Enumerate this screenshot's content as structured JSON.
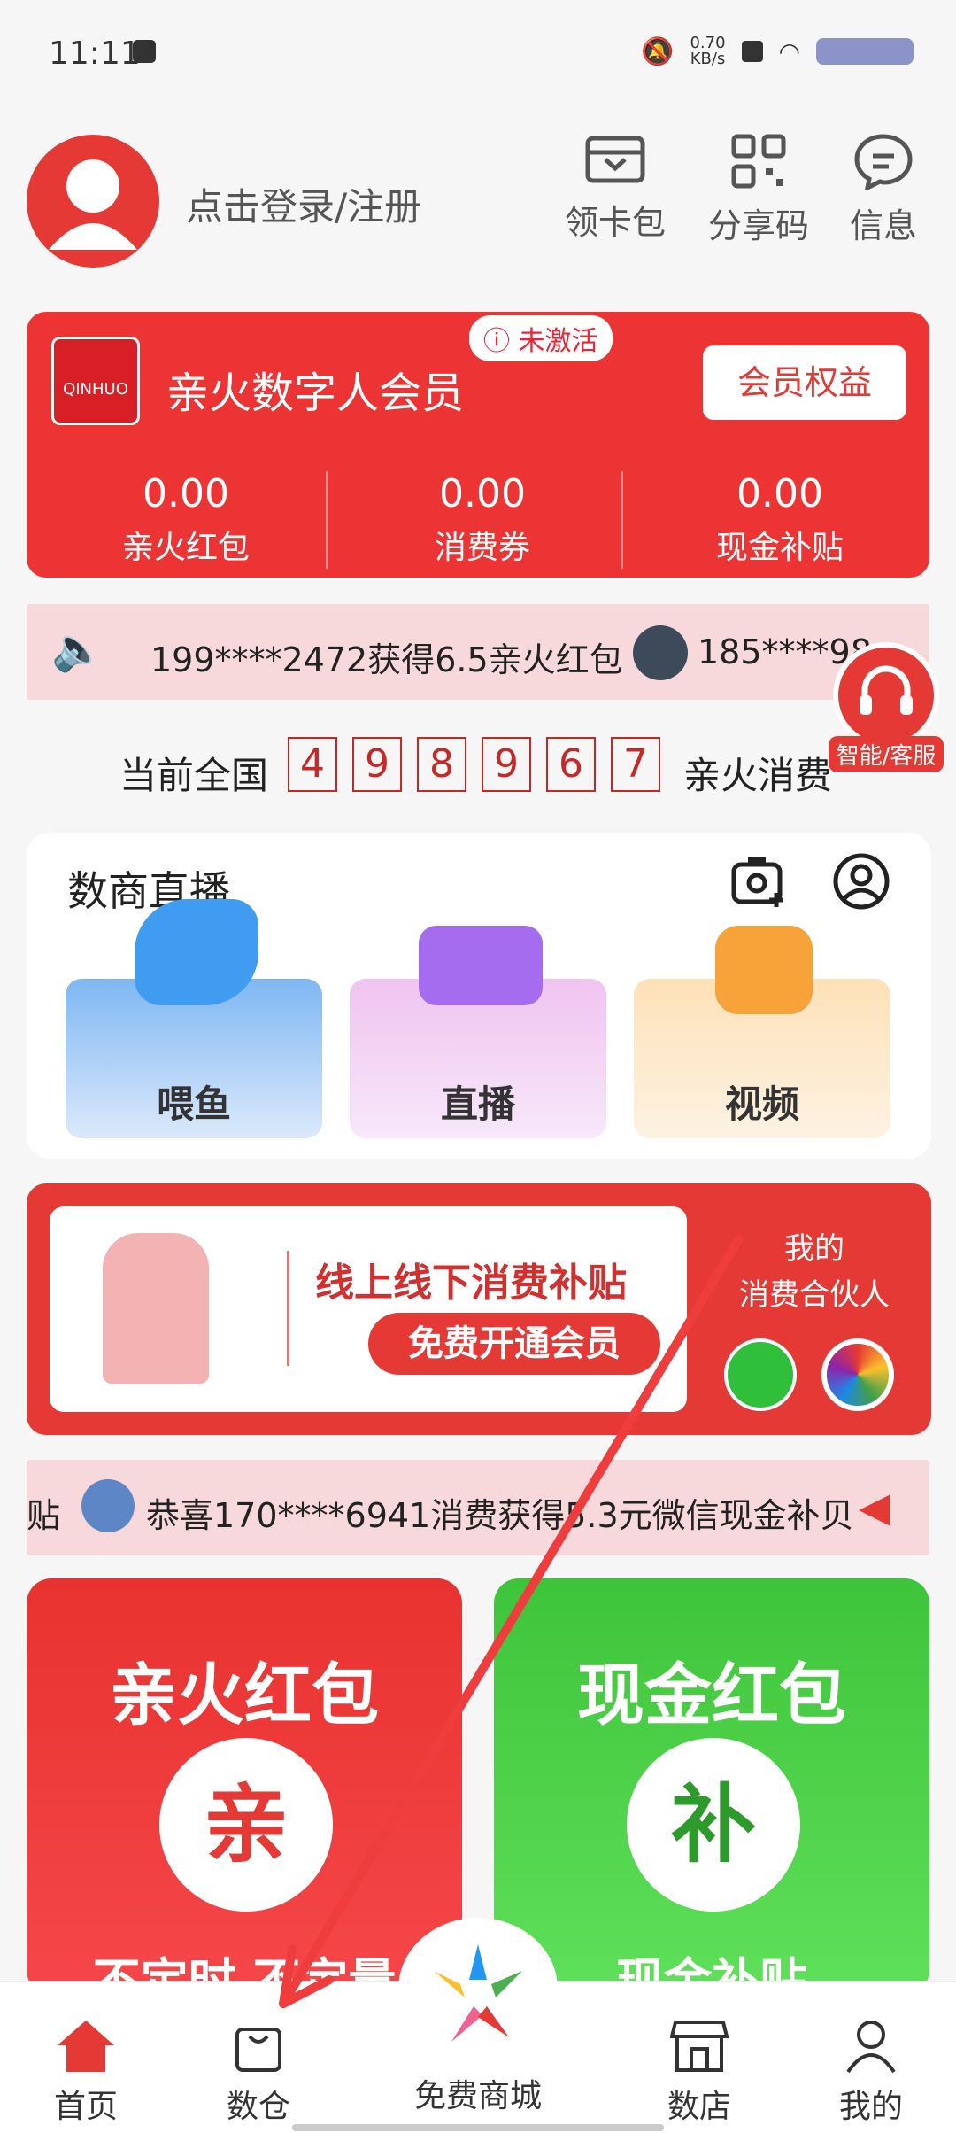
{
  "status_bar": {
    "time": "11:11",
    "net_speed": "0.70",
    "net_unit": "KB/s"
  },
  "header": {
    "login_text": "点击登录/注册",
    "actions": [
      {
        "label": "领卡包",
        "icon": "card-wallet-icon"
      },
      {
        "label": "分享码",
        "icon": "qr-code-icon"
      },
      {
        "label": "信息",
        "icon": "message-icon"
      }
    ]
  },
  "member_card": {
    "logo_text": "QINHUO",
    "title": "亲火数字人会员",
    "badge": "未激活",
    "rights_button": "会员权益",
    "stats": [
      {
        "value": "0.00",
        "label": "亲火红包"
      },
      {
        "value": "0.00",
        "label": "消费券"
      },
      {
        "value": "0.00",
        "label": "现金补贴"
      }
    ]
  },
  "marquee1": {
    "text1": "199****2472获得6.5亲火红包",
    "text2": "185****98"
  },
  "counter": {
    "prefix": "当前全国",
    "digits": [
      "4",
      "9",
      "8",
      "9",
      "6",
      "7"
    ],
    "suffix": "亲火消费"
  },
  "customer_service": {
    "label": "智能/客服"
  },
  "live": {
    "title": "数商直播",
    "tiles": [
      {
        "label": "喂鱼",
        "icon": "fish-icon"
      },
      {
        "label": "直播",
        "icon": "video-camera-icon"
      },
      {
        "label": "视频",
        "icon": "play-icon"
      }
    ]
  },
  "promo": {
    "headline": "线上线下消费补贴",
    "button": "免费开通会员",
    "right_line1": "我的",
    "right_line2": "消费合伙人"
  },
  "marquee2": {
    "prefix": "贴",
    "text": "恭喜170****6941消费获得5.3元微信现金补贝"
  },
  "red_packets": [
    {
      "title": "亲火红包",
      "char": "亲",
      "sub": "不定时 不定量"
    },
    {
      "title": "现金红包",
      "char": "补",
      "sub": "现金补贴"
    }
  ],
  "bottom_nav": [
    {
      "label": "首页",
      "icon": "home-icon"
    },
    {
      "label": "数仓",
      "icon": "shopping-bag-icon"
    },
    {
      "label": "免费商城",
      "icon": "mall-logo-icon"
    },
    {
      "label": "数店",
      "icon": "store-icon"
    },
    {
      "label": "我的",
      "icon": "user-icon"
    }
  ],
  "colors": {
    "brand_red": "#e53935",
    "green": "#43c23a"
  }
}
